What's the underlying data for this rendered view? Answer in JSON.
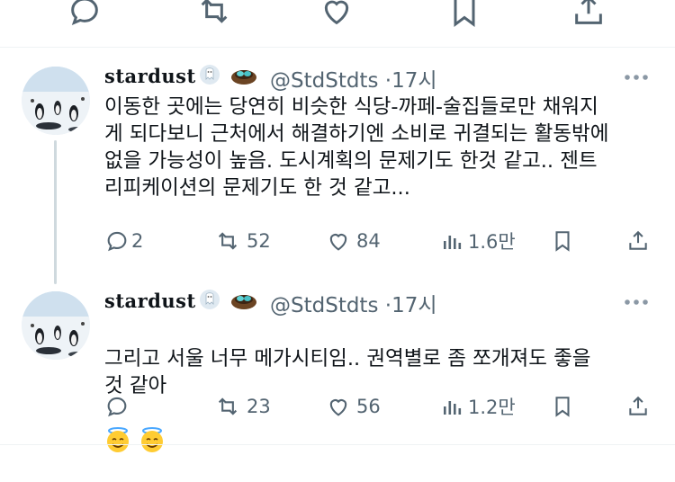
{
  "top_actions": {
    "reply_icon": "reply-icon",
    "retweet_icon": "retweet-icon",
    "like_icon": "heart-icon",
    "bookmark_icon": "bookmark-icon",
    "share_icon": "share-icon"
  },
  "tweets": [
    {
      "display_name": "stardust",
      "handle": "@StdStdts",
      "separator": "·",
      "time": "17시",
      "text": "이동한 곳에는 당연히 비슷한 식당-까페-술집들로만 채워지\n게 되다보니 근처에서 해결하기엔 소비로 귀결되는 활동밖에\n없을 가능성이 높음. 도시계획의 문제기도 한것 같고.. 젠트\n리피케이션의 문제기도 한 것 같고...",
      "stats": {
        "replies": "2",
        "retweets": "52",
        "likes": "84",
        "views": "1.6만"
      }
    },
    {
      "display_name": "stardust",
      "handle": "@StdStdts",
      "separator": "·",
      "time": "17시",
      "text": "그리고 서울 너무 메가시티임.. 권역별로 좀 쪼개져도 좋을\n것 같아",
      "stats": {
        "replies": "",
        "retweets": "23",
        "likes": "56",
        "views": "1.2만"
      }
    }
  ],
  "colors": {
    "text": "#0f1419",
    "secondary": "#536471",
    "divider": "#eff3f4",
    "thread_line": "#cfd9de"
  }
}
